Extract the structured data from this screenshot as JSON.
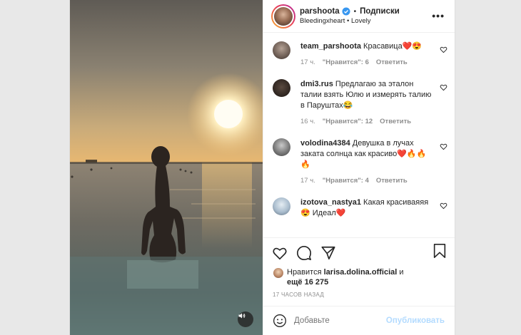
{
  "header": {
    "username": "parshoota",
    "separator": "•",
    "follow_label": "Подписки",
    "audio_artist": "Bleedingxheart",
    "audio_separator": "•",
    "audio_track": "Lovely",
    "more_label": "•••"
  },
  "comments": [
    {
      "user": "team_parshoota",
      "text": "Красавица❤️😍",
      "time": "17 ч.",
      "likes": "\"Нравится\": 6",
      "reply": "Ответить",
      "avatar_color": "#8a7b70"
    },
    {
      "user": "dmi3.rus",
      "text": "Предлагаю за эталон талии взять Юлю и измерять талию в Паруштах😂",
      "time": "16 ч.",
      "likes": "\"Нравится\": 12",
      "reply": "Ответить",
      "avatar_color": "#3d3129"
    },
    {
      "user": "volodina4384",
      "text": "Девушка в лучах заката солнца как красиво❤️🔥🔥🔥",
      "time": "17 ч.",
      "likes": "\"Нравится\": 4",
      "reply": "Ответить",
      "avatar_color": "#6c6c6c"
    },
    {
      "user": "izotova_nastya1",
      "text": "Какая красиваяяя😍 Идеал❤️",
      "time": "",
      "likes": "",
      "reply": "",
      "avatar_color": "#9fb6cc"
    }
  ],
  "likes": {
    "prefix": "Нравится",
    "user": "larisa.dolina.official",
    "and": "и",
    "more": "ещё 16 275"
  },
  "time_ago": "17 ЧАСОВ НАЗАД",
  "add_comment": {
    "placeholder": "Добавьте",
    "publish_label": "Опубликовать"
  },
  "colors": {
    "link_disabled": "#b3dbff",
    "verified": "#3897f0",
    "text": "#262626",
    "muted": "#8e8e8e"
  }
}
